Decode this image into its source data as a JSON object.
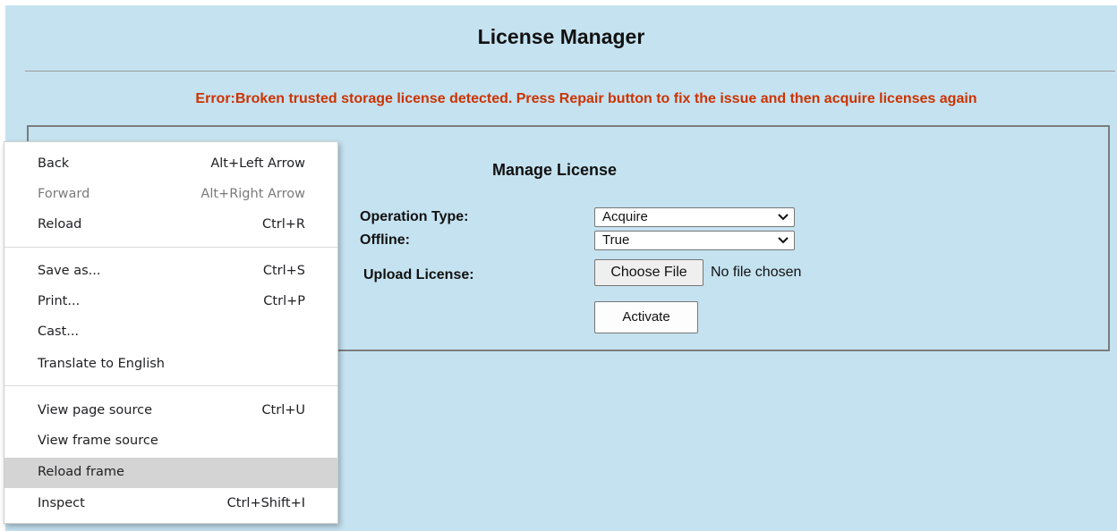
{
  "page": {
    "title": "License Manager",
    "error_message": "Error:Broken trusted storage license detected. Press Repair button to fix the issue and then acquire licenses again",
    "colors": {
      "background": "#c5e2f0",
      "error": "#cc3300",
      "menu_hover": "#d4d4d4"
    }
  },
  "manage": {
    "title": "Manage License",
    "operation_type": {
      "label": "Operation Type:",
      "value": "Acquire"
    },
    "offline": {
      "label": "Offline:",
      "value": "True"
    },
    "upload": {
      "label": "Upload License:",
      "button": "Choose File",
      "status": "No file chosen"
    },
    "activate_label": "Activate"
  },
  "context_menu": {
    "items": [
      {
        "label": "Back",
        "shortcut": "Alt+Left Arrow",
        "disabled": false
      },
      {
        "label": "Forward",
        "shortcut": "Alt+Right Arrow",
        "disabled": true
      },
      {
        "label": "Reload",
        "shortcut": "Ctrl+R",
        "disabled": false
      },
      {
        "label": "Save as...",
        "shortcut": "Ctrl+S",
        "disabled": false
      },
      {
        "label": "Print...",
        "shortcut": "Ctrl+P",
        "disabled": false
      },
      {
        "label": "Cast...",
        "shortcut": "",
        "disabled": false
      },
      {
        "label": "Translate to English",
        "shortcut": "",
        "disabled": false
      },
      {
        "label": "View page source",
        "shortcut": "Ctrl+U",
        "disabled": false
      },
      {
        "label": "View frame source",
        "shortcut": "",
        "disabled": false
      },
      {
        "label": "Reload frame",
        "shortcut": "",
        "disabled": false,
        "highlighted": true
      },
      {
        "label": "Inspect",
        "shortcut": "Ctrl+Shift+I",
        "disabled": false
      }
    ]
  }
}
